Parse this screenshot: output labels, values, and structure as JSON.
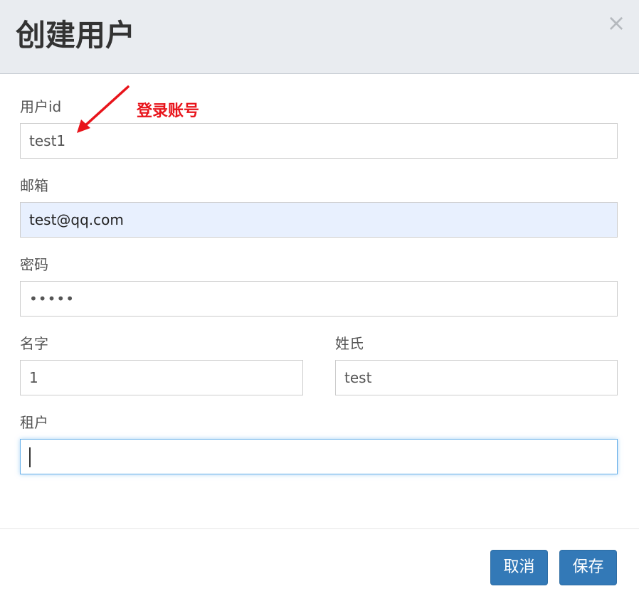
{
  "dialog": {
    "title": "创建用户",
    "close_symbol": "×"
  },
  "annotation": {
    "text": "登录账号",
    "color": "#e8141b",
    "icon": "arrow-icon"
  },
  "form": {
    "user_id": {
      "label": "用户id",
      "value": "test1"
    },
    "email": {
      "label": "邮箱",
      "value": "test@qq.com"
    },
    "password": {
      "label": "密码",
      "value": "•••••"
    },
    "first_name": {
      "label": "名字",
      "value": "1"
    },
    "last_name": {
      "label": "姓氏",
      "value": "test"
    },
    "tenant": {
      "label": "租户",
      "value": ""
    }
  },
  "footer": {
    "cancel_label": "取消",
    "save_label": "保存",
    "button_color": "#3379b7"
  }
}
